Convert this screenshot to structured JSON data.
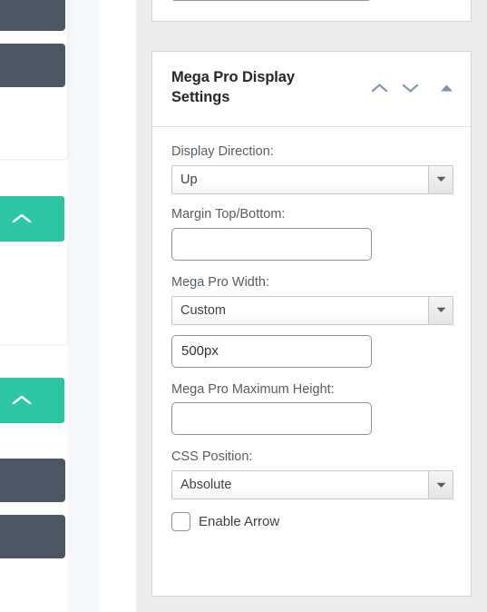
{
  "panel": {
    "title": "Mega Pro Display Settings",
    "header_icons": [
      {
        "name": "move-up-icon",
        "glyph": "chevron-up"
      },
      {
        "name": "move-down-icon",
        "glyph": "chevron-down"
      },
      {
        "name": "collapse-toggle-icon",
        "glyph": "triangle-up"
      }
    ],
    "fields": [
      {
        "label": "Display Direction:",
        "type": "select",
        "value": "Up",
        "name": "display-direction"
      },
      {
        "label": "Margin Top/Bottom:",
        "type": "text",
        "value": "",
        "placeholder": "",
        "name": "margin-top-bottom"
      },
      {
        "label": "Mega Pro Width:",
        "type": "select",
        "value": "Custom",
        "name": "mega-pro-width"
      },
      {
        "label": "",
        "type": "text",
        "value": "500px",
        "placeholder": "",
        "name": "mega-pro-width-custom"
      },
      {
        "label": "Mega Pro Maximum Height:",
        "type": "text",
        "value": "",
        "placeholder": "",
        "name": "mega-pro-maximum-height"
      },
      {
        "label": "CSS Position:",
        "type": "select",
        "value": "Absolute",
        "name": "css-position"
      }
    ],
    "checkbox": {
      "label": "Enable Arrow",
      "checked": false,
      "name": "enable-arrow"
    }
  },
  "sidebar": {
    "widgets": [
      {
        "name": "dark-block",
        "kind": "block"
      },
      {
        "name": "dark-block",
        "kind": "block"
      },
      {
        "name": "teal-collapse-button",
        "kind": "teal"
      },
      {
        "name": "teal-collapse-button",
        "kind": "teal"
      },
      {
        "name": "dark-block",
        "kind": "block"
      },
      {
        "name": "dark-block",
        "kind": "block"
      }
    ]
  },
  "colors": {
    "accent_teal": "#2bc4a4",
    "dark_slate": "#4d5763",
    "page_grey": "#ededed",
    "pale_blue": "#f4f8fa",
    "icon_blue_grey": "#7f93ab",
    "label_text": "#555f68",
    "title_text": "#23282d",
    "border_grey": "#d6d6d6",
    "input_border": "#8f939a"
  }
}
